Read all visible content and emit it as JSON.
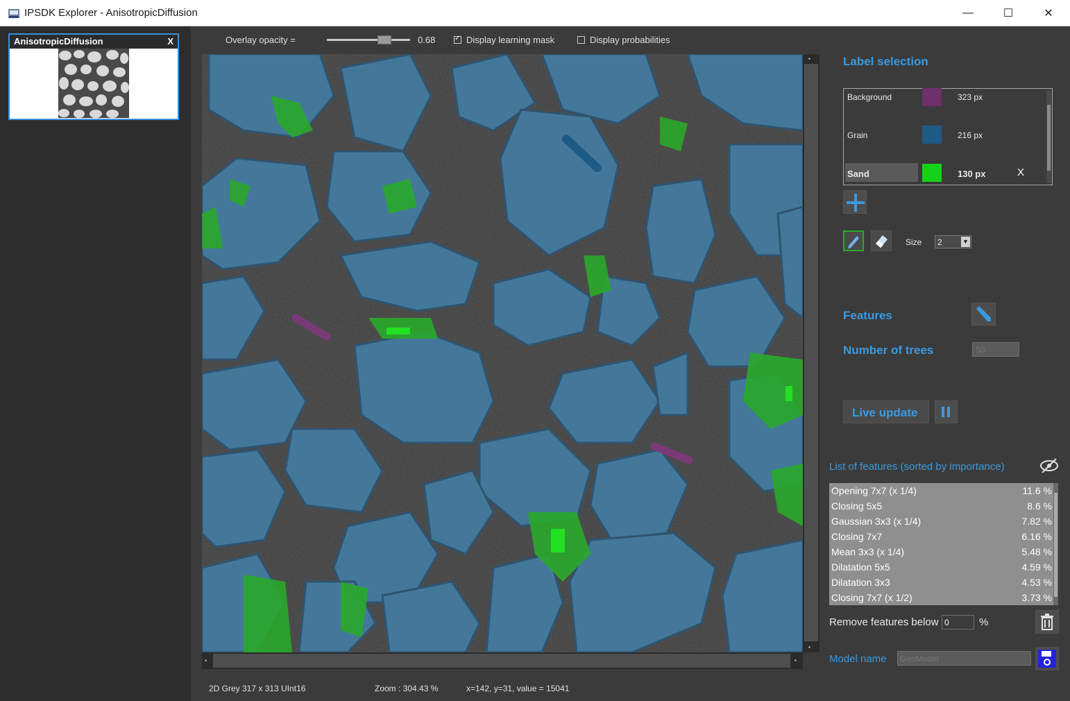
{
  "window": {
    "title": "IPSDK Explorer - AnisotropicDiffusion",
    "minimize_glyph": "—",
    "maximize_glyph": "☐",
    "close_glyph": "✕"
  },
  "thumbnail": {
    "title": "AnisotropicDiffusion",
    "close_label": "X"
  },
  "toolbar": {
    "opacity_label": "Overlay opacity =",
    "opacity_value": "0.68",
    "opacity_level": 0.68,
    "learning_mask_label": "Display learning mask",
    "learning_mask_checked": true,
    "probabilities_label": "Display probabilities",
    "probabilities_checked": false
  },
  "status_bar": {
    "image_info": "2D Grey 317 x 313 UInt16",
    "zoom": "Zoom : 304.43 %",
    "cursor": "x=142, y=31, value = 15041"
  },
  "label_selection": {
    "heading": "Label selection",
    "labels": [
      {
        "name": "Background",
        "count": "323 px",
        "color": "#6e2f6b",
        "selected": false
      },
      {
        "name": "Grain",
        "count": "216 px",
        "color": "#1d5a86",
        "selected": false
      },
      {
        "name": "Sand",
        "count": "130 px",
        "color": "#16d216",
        "selected": true
      }
    ],
    "remove_label": "X",
    "add_icon": "plus-icon"
  },
  "brush": {
    "size_label": "Size",
    "size_value": "2",
    "pen_icon": "pen-icon",
    "eraser_icon": "eraser-icon"
  },
  "features": {
    "heading": "Features"
  },
  "trees": {
    "heading": "Number of trees",
    "placeholder": "50"
  },
  "live_update": {
    "label": "Live update",
    "pause_icon": "pause-icon"
  },
  "feature_list": {
    "heading": "List of features (sorted by importance)",
    "items": [
      {
        "name": "Opening 7x7 (x 1/4)",
        "value": "11.6 %"
      },
      {
        "name": "Closing 5x5",
        "value": "8.6 %"
      },
      {
        "name": "Gaussian 3x3 (x 1/4)",
        "value": "7.82 %"
      },
      {
        "name": "Closing 7x7",
        "value": "6.16 %"
      },
      {
        "name": "Mean 3x3 (x 1/4)",
        "value": "5.48 %"
      },
      {
        "name": "Dilatation 5x5",
        "value": "4.59 %"
      },
      {
        "name": "Dilatation 3x3",
        "value": "4.53 %"
      },
      {
        "name": "Closing 7x7 (x 1/2)",
        "value": "3.73 %"
      }
    ],
    "remove_label": "Remove features below",
    "remove_value": "0",
    "remove_unit": "%"
  },
  "model": {
    "label": "Model name",
    "placeholder": "GeoModel"
  },
  "colors": {
    "accent": "#3a9ae0",
    "grain_overlay": "#44789a",
    "sand_overlay": "#2aa82a",
    "dark_pore": "#2a2a2a"
  }
}
